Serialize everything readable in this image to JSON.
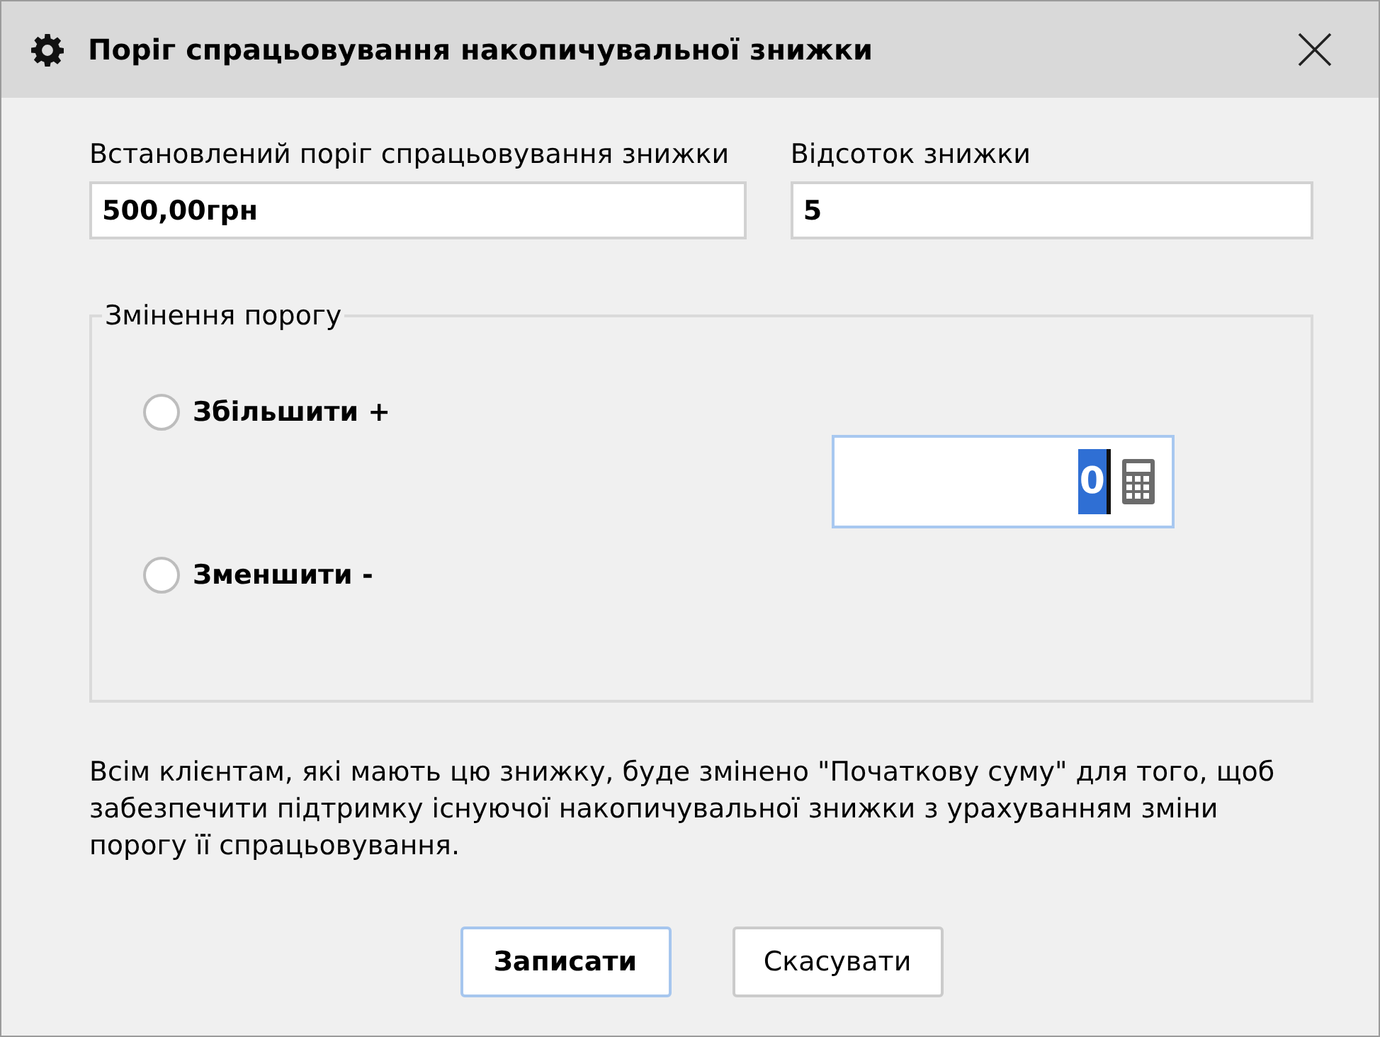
{
  "window": {
    "title": "Поріг спрацьовування накопичувальної знижки"
  },
  "fields": [
    {
      "label": "Встановлений поріг спрацьовування знижки",
      "value": "500,00грн"
    },
    {
      "label": "Відсоток знижки",
      "value": "5"
    }
  ],
  "threshold_change": {
    "title": "Змінення порогу",
    "options": [
      {
        "label": "Збільшити +",
        "selected": false
      },
      {
        "label": "Зменшити -",
        "selected": false
      }
    ],
    "amount": {
      "value": "0",
      "text_selected": true
    }
  },
  "note": "Всім клієнтам, які мають цю знижку, буде змінено \"Початкову суму\" для того, щоб забезпечити підтримку існуючої накопичувальної знижки з урахуванням зміни порогу її спрацьовування.",
  "buttons": [
    {
      "label": "Записати",
      "default": true
    },
    {
      "label": "Скасувати",
      "default": false
    }
  ]
}
